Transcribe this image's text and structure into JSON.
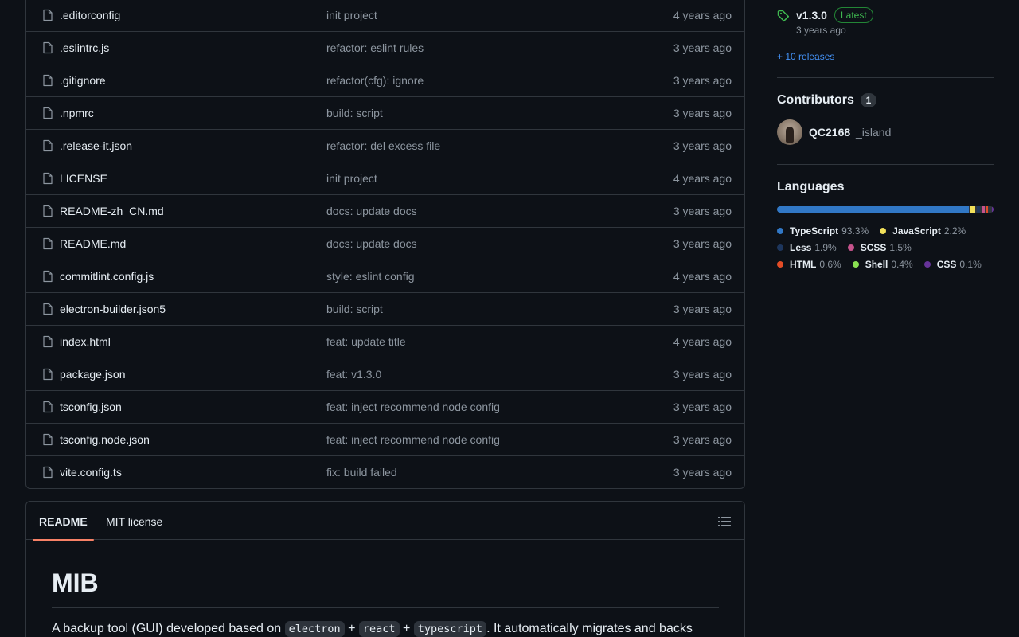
{
  "files": [
    {
      "name": ".editorconfig",
      "commit": "init project",
      "time": "4 years ago"
    },
    {
      "name": ".eslintrc.js",
      "commit": "refactor: eslint rules",
      "time": "3 years ago"
    },
    {
      "name": ".gitignore",
      "commit": "refactor(cfg): ignore",
      "time": "3 years ago"
    },
    {
      "name": ".npmrc",
      "commit": "build: script",
      "time": "3 years ago"
    },
    {
      "name": ".release-it.json",
      "commit": "refactor: del excess file",
      "time": "3 years ago"
    },
    {
      "name": "LICENSE",
      "commit": "init project",
      "time": "4 years ago"
    },
    {
      "name": "README-zh_CN.md",
      "commit": "docs: update docs",
      "time": "3 years ago"
    },
    {
      "name": "README.md",
      "commit": "docs: update docs",
      "time": "3 years ago"
    },
    {
      "name": "commitlint.config.js",
      "commit": "style: eslint config",
      "time": "4 years ago"
    },
    {
      "name": "electron-builder.json5",
      "commit": "build: script",
      "time": "3 years ago"
    },
    {
      "name": "index.html",
      "commit": "feat: update title",
      "time": "4 years ago"
    },
    {
      "name": "package.json",
      "commit": "feat: v1.3.0",
      "time": "3 years ago"
    },
    {
      "name": "tsconfig.json",
      "commit": "feat: inject recommend node config",
      "time": "3 years ago"
    },
    {
      "name": "tsconfig.node.json",
      "commit": "feat: inject recommend node config",
      "time": "3 years ago"
    },
    {
      "name": "vite.config.ts",
      "commit": "fix: build failed",
      "time": "3 years ago"
    }
  ],
  "readme": {
    "tabs": [
      "README",
      "MIT license"
    ],
    "title": "MIB",
    "paragraph": {
      "before": "A backup tool (GUI) developed based on ",
      "code1": "electron",
      "plus1": " + ",
      "code2": "react",
      "plus2": " + ",
      "code3": "typescript",
      "after": ". It automatically migrates and backs"
    }
  },
  "sidebar": {
    "release": {
      "version": "v1.3.0",
      "badge": "Latest",
      "date": "3 years ago",
      "more": "+ 10 releases"
    },
    "contributors": {
      "heading": "Contributors",
      "count": "1",
      "login": "QC2168",
      "name": "_island"
    },
    "languages": {
      "heading": "Languages",
      "items": [
        {
          "name": "TypeScript",
          "pct": "93.3%",
          "value": 93.3,
          "color": "#3178c6"
        },
        {
          "name": "JavaScript",
          "pct": "2.2%",
          "value": 2.2,
          "color": "#f1e05a"
        },
        {
          "name": "Less",
          "pct": "1.9%",
          "value": 1.9,
          "color": "#1d365d"
        },
        {
          "name": "SCSS",
          "pct": "1.5%",
          "value": 1.5,
          "color": "#c6538c"
        },
        {
          "name": "HTML",
          "pct": "0.6%",
          "value": 0.6,
          "color": "#e34c26"
        },
        {
          "name": "Shell",
          "pct": "0.4%",
          "value": 0.4,
          "color": "#89e051"
        },
        {
          "name": "CSS",
          "pct": "0.1%",
          "value": 0.1,
          "color": "#663399"
        }
      ]
    }
  },
  "icons": {
    "file": "file-icon",
    "tag": "tag-icon",
    "outline": "list-unordered-icon"
  },
  "colors": {
    "background": "#0d1117",
    "border": "#30363d",
    "link": "#4493f8",
    "muted": "#8d96a0",
    "tab_underline": "#f78166",
    "latest": "#3fb950"
  }
}
